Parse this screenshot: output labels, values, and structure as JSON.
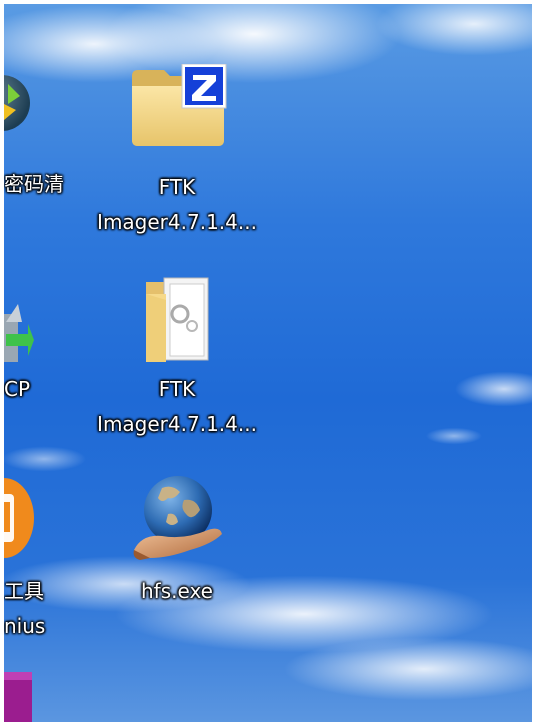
{
  "desktop": {
    "left_column": {
      "item1_label": "密码清",
      "item2_label": "CP",
      "item3_label_line1": "工具",
      "item3_label_line2": "nius"
    },
    "icons": [
      {
        "label_line1": "FTK",
        "label_line2": "Imager4.7.1.4...",
        "icon": "winrar-zip-folder-icon"
      },
      {
        "label_line1": "FTK",
        "label_line2": "Imager4.7.1.4...",
        "icon": "folder-icon"
      },
      {
        "label_line1": "hfs.exe",
        "icon": "globe-in-hand-icon"
      }
    ],
    "colors": {
      "sky": "#2f79dc",
      "label_text": "#ffffff"
    }
  }
}
